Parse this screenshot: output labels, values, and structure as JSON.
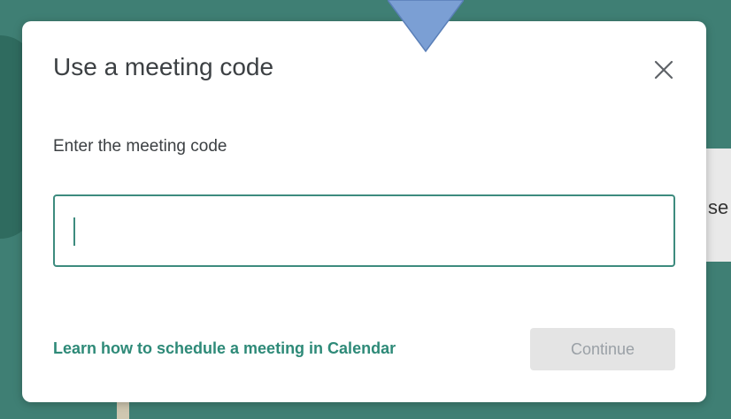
{
  "dialog": {
    "title": "Use a meeting code",
    "close_icon": "close-icon",
    "field_label": "Enter the meeting code",
    "input": {
      "value": "",
      "placeholder": ""
    },
    "learn_link": "Learn how to schedule a meeting in Calendar",
    "continue_label": "Continue",
    "continue_disabled": true
  },
  "background": {
    "partial_text": "se"
  },
  "colors": {
    "accent": "#3d8b7e",
    "link": "#2e8a78",
    "backdrop": "#3f7f74",
    "pointer_arrow": "#7b9fd4"
  }
}
